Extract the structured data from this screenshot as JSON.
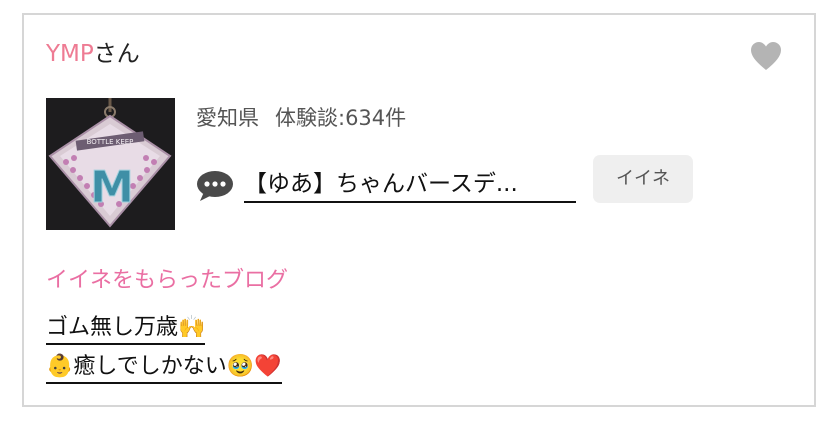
{
  "user": {
    "name": "YMP",
    "suffix": "さん"
  },
  "favorite": {
    "icon": "heart-icon",
    "color": "#b4b4b4"
  },
  "profile": {
    "thumbnail_text": "BOTTLE KEEP",
    "thumbnail_letter": "M"
  },
  "meta": {
    "location": "愛知県",
    "reviews": "体験談:634件"
  },
  "post": {
    "icon": "speech-bubble-icon",
    "title": "【ゆあ】ちゃんバースデ...",
    "iine_label": "イイネ"
  },
  "liked_blogs": {
    "heading": "イイネをもらったブログ",
    "items": [
      {
        "title": "ゴム無し万歳🙌"
      },
      {
        "title": "👶癒しでしかない🥹❤️"
      }
    ]
  },
  "colors": {
    "accent_name": "#ee7b93",
    "accent_section": "#ea6fa3",
    "border": "#d6d6d6",
    "button_bg": "#efefef"
  }
}
